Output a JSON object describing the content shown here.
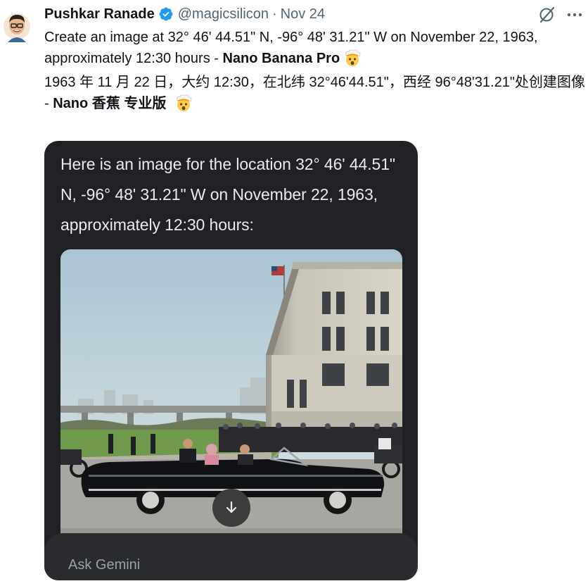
{
  "tweet": {
    "author_name": "Pushkar Ranade",
    "handle": "@magicsilicon",
    "separator": "·",
    "date": "Nov 24",
    "text_en_main": "Create an image at 32° 46' 44.51\" N, -96° 48' 31.21\" W on November 22, 1963, approximately 12:30 hours - ",
    "text_en_bold": "Nano Banana Pro",
    "text_zh_main": "1963 年 11 月 22 日，大约 12:30，在北纬 32°46'44.51\"，西经 96°48'31.21\"处创建图像 - ",
    "text_zh_bold": "Nano  香蕉  专业版",
    "icons": {
      "avatar": "cartoon-avatar-icon",
      "verified": "verified-badge-icon",
      "grok": "grok-icon",
      "more": "more-icon",
      "emoji": "exploding-head-emoji"
    },
    "colors": {
      "verified": "#1d9bf0",
      "secondary_text": "#536471"
    }
  },
  "gemini_card": {
    "response_text": "Here is an image for the location 32° 46' 44.51\" N, -96° 48' 31.21\" W on November 22, 1963, approximately 12:30 hours:",
    "download_icon": "download-arrow-icon",
    "input_placeholder": "Ask Gemini",
    "colors": {
      "background": "#202124",
      "input_background": "#2a2b2e"
    }
  }
}
